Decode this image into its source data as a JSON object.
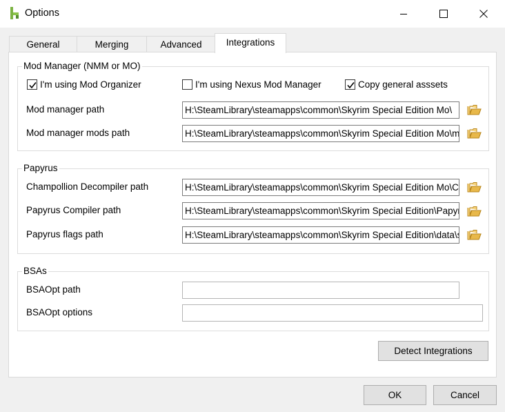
{
  "window": {
    "title": "Options",
    "icon": "app-logo-icon"
  },
  "tabs": [
    {
      "label": "General"
    },
    {
      "label": "Merging"
    },
    {
      "label": "Advanced"
    },
    {
      "label": "Integrations",
      "active": true
    }
  ],
  "mod_manager": {
    "title": "Mod Manager (NMM or MO)",
    "checkboxes": [
      {
        "label": "I'm using Mod Organizer",
        "checked": true
      },
      {
        "label": "I'm using Nexus Mod Manager",
        "checked": false
      },
      {
        "label": "Copy general asssets",
        "checked": true
      }
    ],
    "path_label": "Mod manager path",
    "path_value": "H:\\SteamLibrary\\steamapps\\common\\Skyrim Special Edition Mo\\",
    "mods_path_label": "Mod manager mods path",
    "mods_path_value": "H:\\SteamLibrary\\steamapps\\common\\Skyrim Special Edition Mo\\mo"
  },
  "papyrus": {
    "title": "Papyrus",
    "decompiler_label": "Champollion Decompiler path",
    "decompiler_value": "H:\\SteamLibrary\\steamapps\\common\\Skyrim Special Edition Mo\\Ch",
    "compiler_label": "Papyrus Compiler path",
    "compiler_value": "H:\\SteamLibrary\\steamapps\\common\\Skyrim Special Edition\\Papyr",
    "flags_label": "Papyrus flags path",
    "flags_value": "H:\\SteamLibrary\\steamapps\\common\\Skyrim Special Edition\\data\\s"
  },
  "bsas": {
    "title": "BSAs",
    "path_label": "BSAOpt path",
    "path_value": "",
    "options_label": "BSAOpt options",
    "options_value": ""
  },
  "buttons": {
    "detect": "Detect Integrations",
    "ok": "OK",
    "cancel": "Cancel"
  },
  "colors": {
    "folder_icon": "#e8b84a",
    "window_bg": "#f0f0f0",
    "panel_bg": "#ffffff"
  }
}
